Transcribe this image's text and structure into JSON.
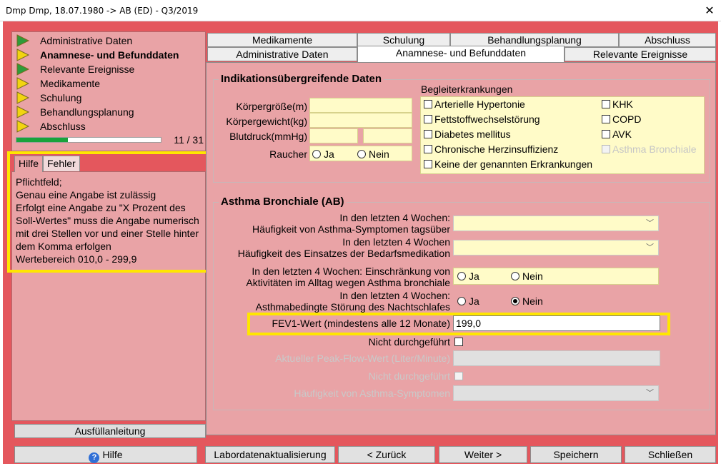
{
  "window": {
    "title": "Dmp Dmp, 18.07.1980 -> AB (ED) - Q3/2019",
    "close_glyph": "✕"
  },
  "nav": {
    "items": [
      {
        "label": "Administrative Daten",
        "status": "green",
        "active": false
      },
      {
        "label": "Anamnese- und Befunddaten",
        "status": "yellow",
        "active": true
      },
      {
        "label": "Relevante Ereignisse",
        "status": "green",
        "active": false
      },
      {
        "label": "Medikamente",
        "status": "yellow",
        "active": false
      },
      {
        "label": "Schulung",
        "status": "yellow",
        "active": false
      },
      {
        "label": "Behandlungsplanung",
        "status": "yellow",
        "active": false
      },
      {
        "label": "Abschluss",
        "status": "yellow",
        "active": false
      }
    ],
    "progress_fraction": 0.355,
    "progress_text": "11 / 31"
  },
  "help": {
    "tab_help": "Hilfe",
    "tab_errors": "Fehler",
    "text": "Pflichtfeld;\nGenau eine Angabe ist zulässig\nErfolgt eine Angabe zu \"X Prozent des Soll-Wertes\" muss die Angabe numerisch mit drei Stellen vor und einer Stelle hinter dem Komma erfolgen\nWertebereich 010,0 - 299,9",
    "button": "Ausfüllanleitung"
  },
  "tabs": {
    "row1": [
      "Medikamente",
      "Schulung",
      "Behandlungsplanung",
      "Abschluss"
    ],
    "row2": [
      "Administrative Daten",
      "Anamnese- und Befunddaten",
      "Relevante Ereignisse"
    ],
    "selected": "Anamnese- und Befunddaten"
  },
  "indikation": {
    "title": "Indikationsübergreifende Daten",
    "groesse_label": "Körpergröße(m)",
    "gewicht_label": "Körpergewicht(kg)",
    "blutdruck_label": "Blutdruck(mmHg)",
    "raucher_label": "Raucher",
    "ja": "Ja",
    "nein": "Nein",
    "begleit_title": "Begleiterkrankungen",
    "begleit_items": [
      "Arterielle Hypertonie",
      "Fettstoffwechselstörung",
      "Diabetes mellitus",
      "Chronische Herzinsuffizienz",
      "Keine der genannten Erkrankungen"
    ],
    "begleit_items_right": [
      "KHK",
      "COPD",
      "AVK",
      "Asthma Bronchiale"
    ]
  },
  "asthma": {
    "title": "Asthma Bronchiale (AB)",
    "q1_line1": "In den letzten 4 Wochen:",
    "q1_line2": "Häufigkeit von Asthma-Symptomen tagsüber",
    "q2_line1": "In den letzten 4 Wochen",
    "q2_line2": "Häufigkeit des Einsatzes der Bedarfsmedikation",
    "q3_line1": "In den letzten 4 Wochen: Einschränkung von",
    "q3_line2": "Aktivitäten im Alltag wegen Asthma bronchiale",
    "q4_line1": "In den letzten 4 Wochen:",
    "q4_line2": "Asthmabedingte Störung des Nachtschlafes",
    "ja": "Ja",
    "nein": "Nein",
    "fev1_label": "FEV1-Wert (mindestens alle 12 Monate)",
    "fev1_value": "199,0",
    "nicht_durchgefuehrt": "Nicht durchgeführt",
    "peakflow_label": "Aktueller Peak-Flow-Wert (Liter/Minute)",
    "nicht_durchgefuehrt2": "Nicht durchgeführt",
    "haeufigkeit_label": "Häufigkeit von Asthma-Symptomen"
  },
  "buttons": {
    "hilfe": "Hilfe",
    "labor": "Labordatenaktualisierung",
    "zurueck": "< Zurück",
    "weiter": "Weiter >",
    "speichern": "Speichern",
    "schliessen": "Schließen"
  },
  "colors": {
    "frame": "#e4575d",
    "panel": "#e9a3a6",
    "field": "#fffbc8",
    "highlight": "#ffe600",
    "progress": "#1aa33b",
    "arrow_green": "#2e9b3a",
    "arrow_yellow": "#f2d410"
  }
}
